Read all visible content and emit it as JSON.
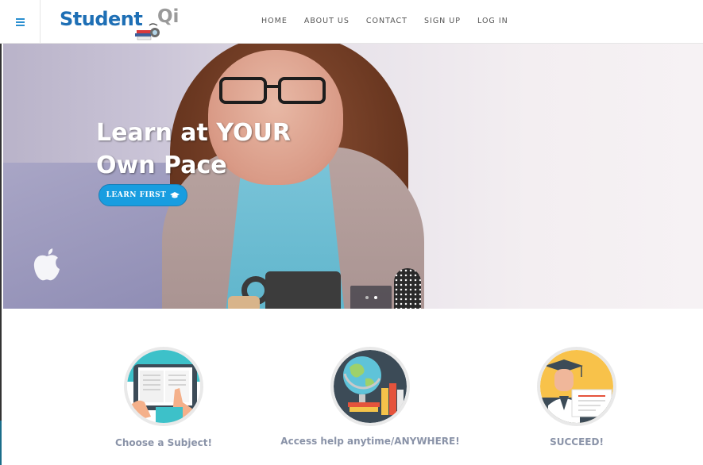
{
  "brand": {
    "name_part1": "Student",
    "name_part2": "Qi"
  },
  "nav": {
    "menu_icon": "hamburger-menu-icon",
    "links": [
      "HOME",
      "ABOUT US",
      "CONTACT",
      "SIGN UP",
      "LOG IN"
    ]
  },
  "hero": {
    "title_line1": "Learn at YOUR",
    "title_line2": "Own Pace",
    "button_label": "LEARN FIRST",
    "button_icon": "graduation-cap-icon",
    "carousel": {
      "slides": 2,
      "active_index": 1
    }
  },
  "features": [
    {
      "label": "Choose a Subject!",
      "icon": "tablet-book-icon"
    },
    {
      "label": "Access help anytime/ANYWHERE!",
      "icon": "globe-books-icon"
    },
    {
      "label": "SUCCEED!",
      "icon": "graduate-diploma-icon"
    }
  ],
  "colors": {
    "accent": "#189de0",
    "brand_blue": "#1e6fb5",
    "feature_label": "#8a93a8"
  }
}
